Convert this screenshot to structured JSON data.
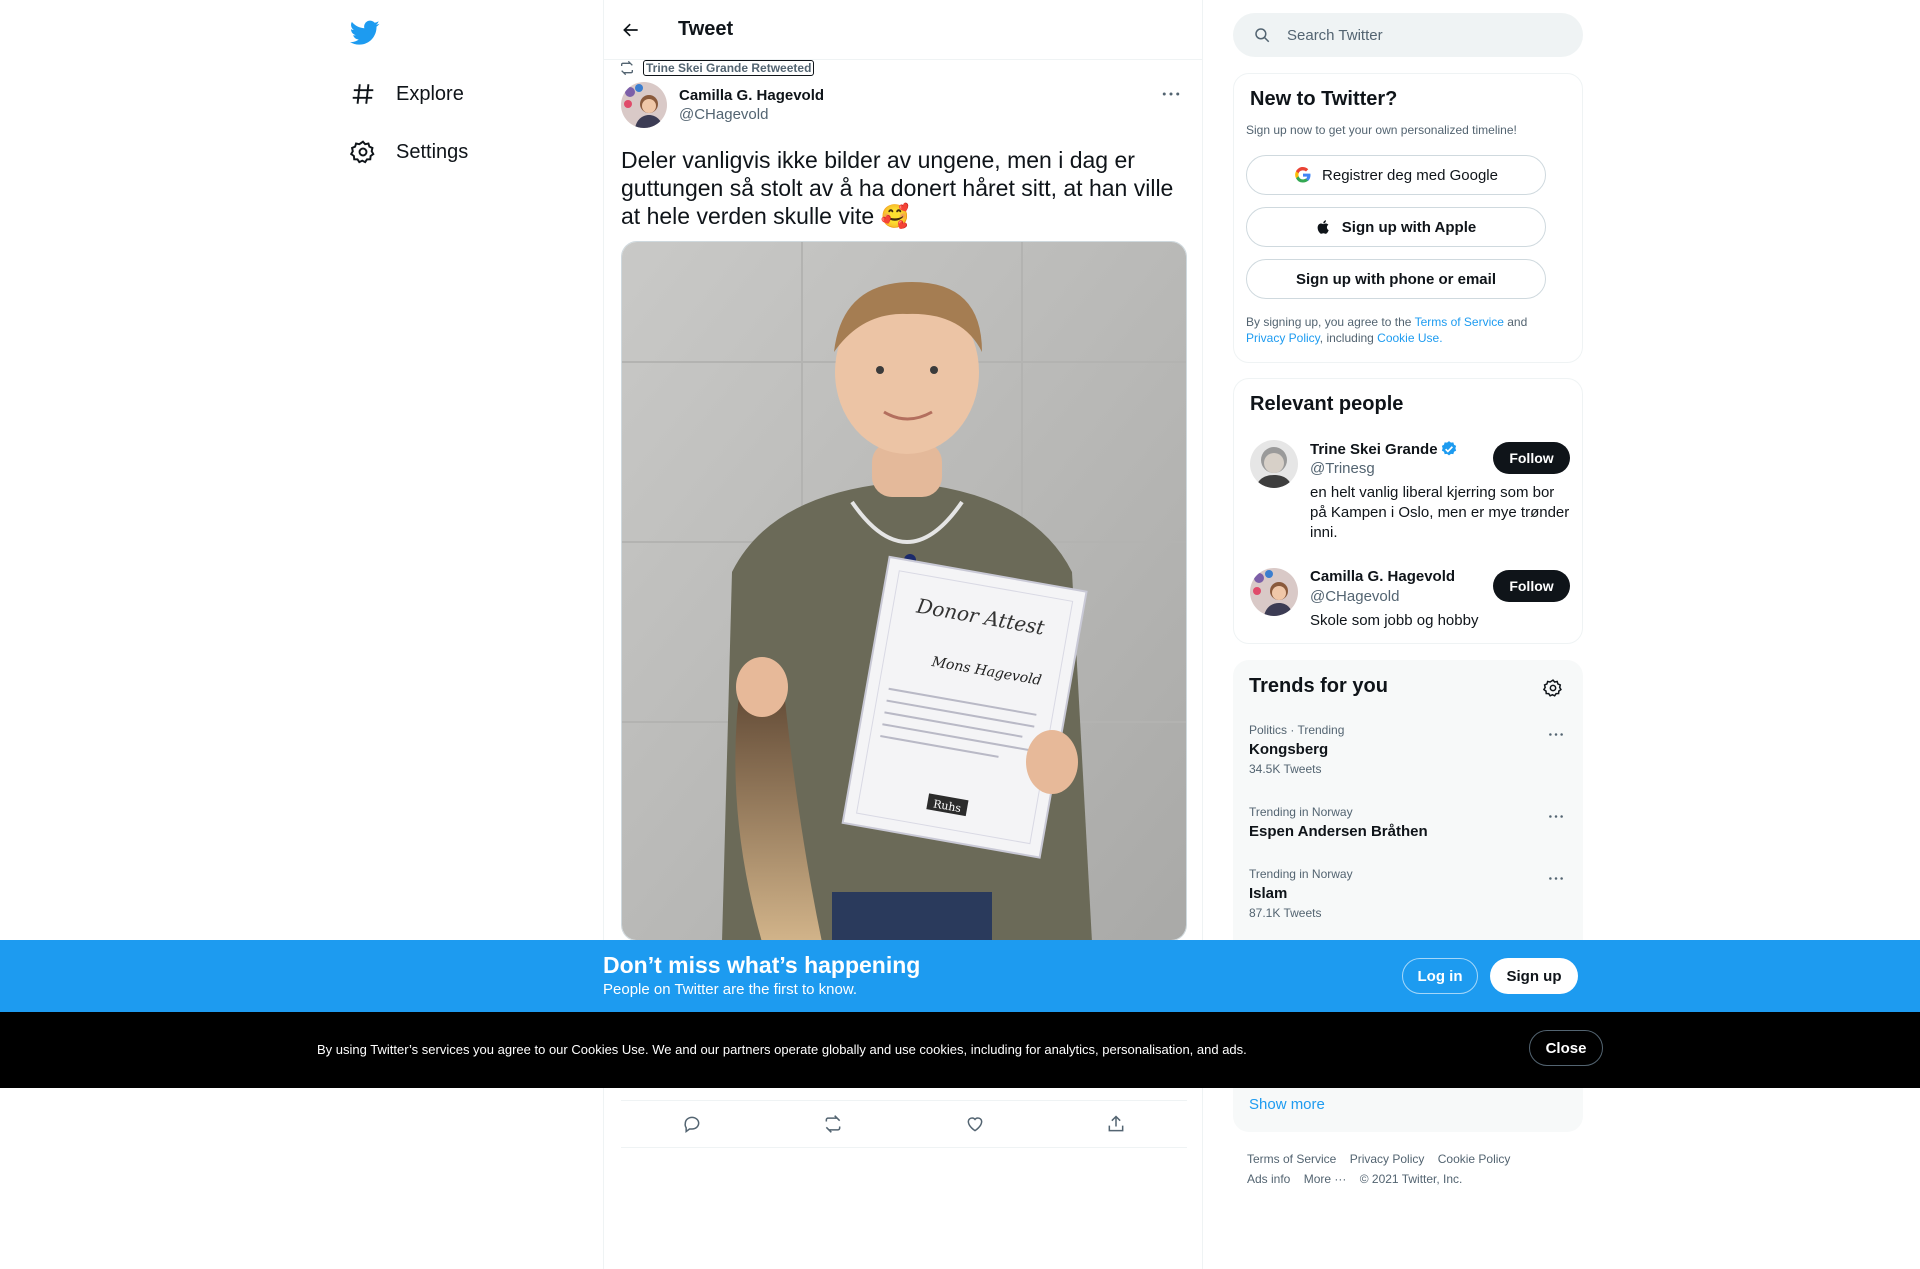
{
  "nav": {
    "explore_label": "Explore",
    "settings_label": "Settings"
  },
  "header": {
    "title": "Tweet"
  },
  "tweet": {
    "retweeted_by": "Trine Skei Grande Retweeted",
    "author_name": "Camilla G. Hagevold",
    "author_handle": "@CHagevold",
    "text": "Deler vanligvis ikke bilder av ungene, men i dag er guttungen så stolt av å ha donert håret sitt, at han ville at hele verden skulle vite 🥰",
    "media_icon": "photo-boy-with-donor-certificate-icon",
    "certificate_title": "Donor Attest",
    "certificate_name": "Mons Hagevold",
    "certificate_brand": "Ruhs"
  },
  "search": {
    "placeholder": "Search Twitter"
  },
  "new_to_twitter": {
    "title": "New to Twitter?",
    "subtitle": "Sign up now to get your own personalized timeline!",
    "google_label": "Registrer deg med Google",
    "apple_label": "Sign up with Apple",
    "phone_label": "Sign up with phone or email",
    "legal_prefix": "By signing up, you agree to the ",
    "terms_link": "Terms of Service",
    "legal_and": " and",
    "privacy_link": "Privacy Policy",
    "legal_including": ", including ",
    "cookie_link": "Cookie Use."
  },
  "relevant_people": {
    "title": "Relevant people",
    "people": [
      {
        "name": "Trine Skei Grande",
        "handle": "@Trinesg",
        "bio": "en helt vanlig liberal kjerring som bor på Kampen i Oslo, men er mye trønder inni.",
        "follow_label": "Follow",
        "verified": true
      },
      {
        "name": "Camilla G. Hagevold",
        "handle": "@CHagevold",
        "bio": "Skole som jobb og hobby",
        "follow_label": "Follow",
        "verified": false
      }
    ]
  },
  "trends": {
    "title": "Trends for you",
    "items": [
      {
        "meta": "Politics · Trending",
        "name": "Kongsberg",
        "count": "34.5K Tweets"
      },
      {
        "meta": "Trending in Norway",
        "name": "Espen Andersen Bråthen",
        "count": ""
      },
      {
        "meta": "Trending in Norway",
        "name": "Islam",
        "count": "87.1K Tweets"
      }
    ],
    "show_more": "Show more"
  },
  "footer": {
    "terms": "Terms of Service",
    "privacy": "Privacy Policy",
    "cookie": "Cookie Policy",
    "ads": "Ads info",
    "more": "More ···",
    "copyright": "© 2021 Twitter, Inc."
  },
  "banner": {
    "title": "Don’t miss what’s happening",
    "subtitle": "People on Twitter are the first to know.",
    "login_label": "Log in",
    "signup_label": "Sign up"
  },
  "cookie_bar": {
    "text": "By using Twitter’s services you agree to our Cookies Use. We and our partners operate globally and use cookies, including for analytics, personalisation, and ads.",
    "close_label": "Close"
  },
  "colors": {
    "accent": "#1d9bf0",
    "text": "#0f1419",
    "muted": "#536471",
    "cookie_bg": "#000000"
  }
}
